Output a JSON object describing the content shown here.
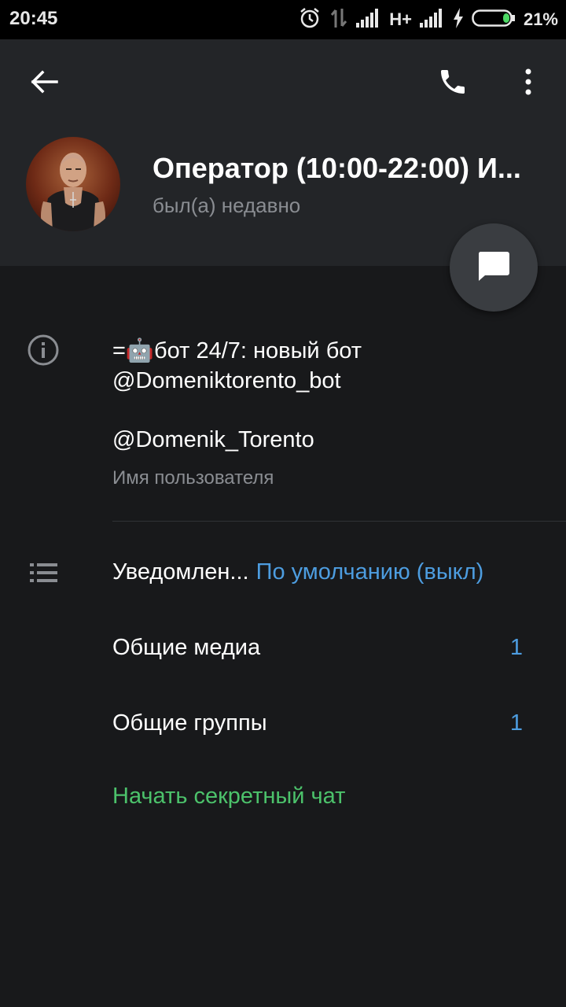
{
  "status_bar": {
    "time": "20:45",
    "network": "H+",
    "battery": "21%",
    "icons": [
      "alarm-icon",
      "data-transfer-icon",
      "signal-icon",
      "signal-icon",
      "charging-icon",
      "battery-icon"
    ]
  },
  "header": {
    "name": "Оператор (10:00-22:00) И...",
    "status": "был(а) недавно",
    "icons": [
      "back-arrow-icon",
      "phone-icon",
      "more-vertical-icon",
      "message-icon"
    ]
  },
  "info": {
    "bio_line1": "=🤖бот 24/7: новый бот",
    "bio_line2": "@Domeniktorento_bot",
    "username": "@Domenik_Torento",
    "username_label": "Имя пользователя"
  },
  "settings": {
    "notifications_label": "Уведомлен...",
    "notifications_value": "По умолчанию (выкл)",
    "shared_media_label": "Общие медиа",
    "shared_media_count": "1",
    "shared_groups_label": "Общие группы",
    "shared_groups_count": "1",
    "secret_chat_label": "Начать секретный чат"
  },
  "colors": {
    "accent": "#4d9de0",
    "secret": "#4cc26b",
    "header_bg": "#232528",
    "body_bg": "#18191b"
  }
}
